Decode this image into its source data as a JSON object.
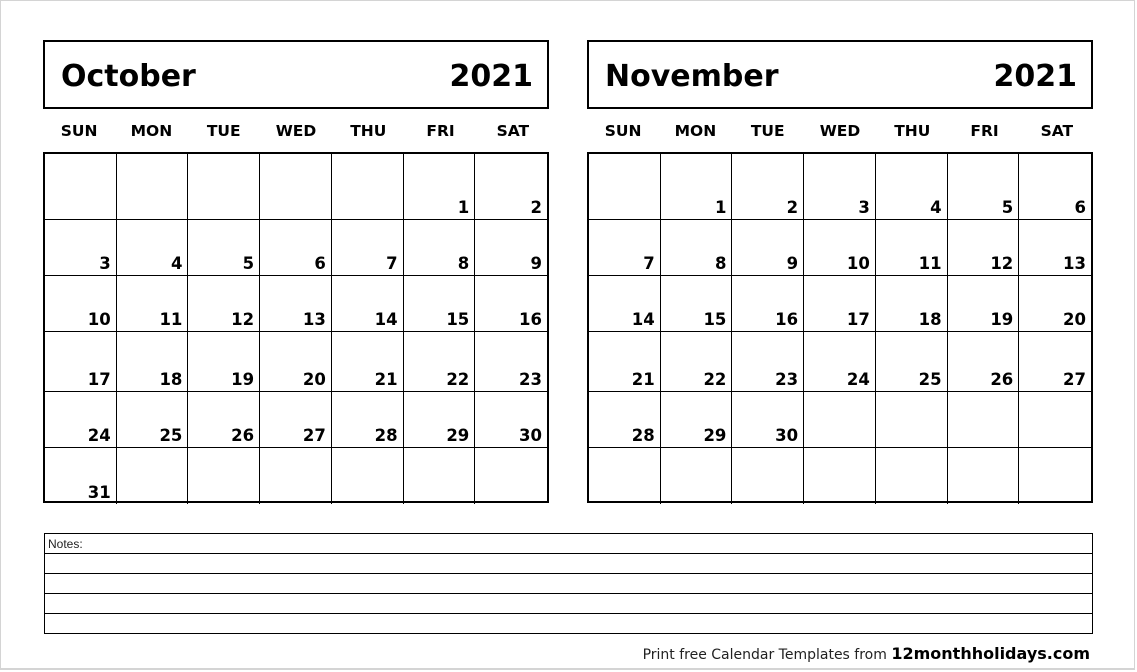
{
  "weekdays": [
    "SUN",
    "MON",
    "TUE",
    "WED",
    "THU",
    "FRI",
    "SAT"
  ],
  "months": [
    {
      "name": "October",
      "year": "2021",
      "weeks": [
        [
          "",
          "",
          "",
          "",
          "",
          "1",
          "2"
        ],
        [
          "3",
          "4",
          "5",
          "6",
          "7",
          "8",
          "9"
        ],
        [
          "10",
          "11",
          "12",
          "13",
          "14",
          "15",
          "16"
        ],
        [
          "17",
          "18",
          "19",
          "20",
          "21",
          "22",
          "23"
        ],
        [
          "24",
          "25",
          "26",
          "27",
          "28",
          "29",
          "30"
        ],
        [
          "31",
          "",
          "",
          "",
          "",
          "",
          ""
        ]
      ]
    },
    {
      "name": "November",
      "year": "2021",
      "weeks": [
        [
          "",
          "1",
          "2",
          "3",
          "4",
          "5",
          "6"
        ],
        [
          "7",
          "8",
          "9",
          "10",
          "11",
          "12",
          "13"
        ],
        [
          "14",
          "15",
          "16",
          "17",
          "18",
          "19",
          "20"
        ],
        [
          "21",
          "22",
          "23",
          "24",
          "25",
          "26",
          "27"
        ],
        [
          "28",
          "29",
          "30",
          "",
          "",
          "",
          ""
        ],
        [
          "",
          "",
          "",
          "",
          "",
          "",
          ""
        ]
      ]
    }
  ],
  "notes": {
    "label": "Notes:",
    "line_count": 5
  },
  "footer": {
    "text": "Print free Calendar Templates from ",
    "site": "12monthholidays.com"
  }
}
